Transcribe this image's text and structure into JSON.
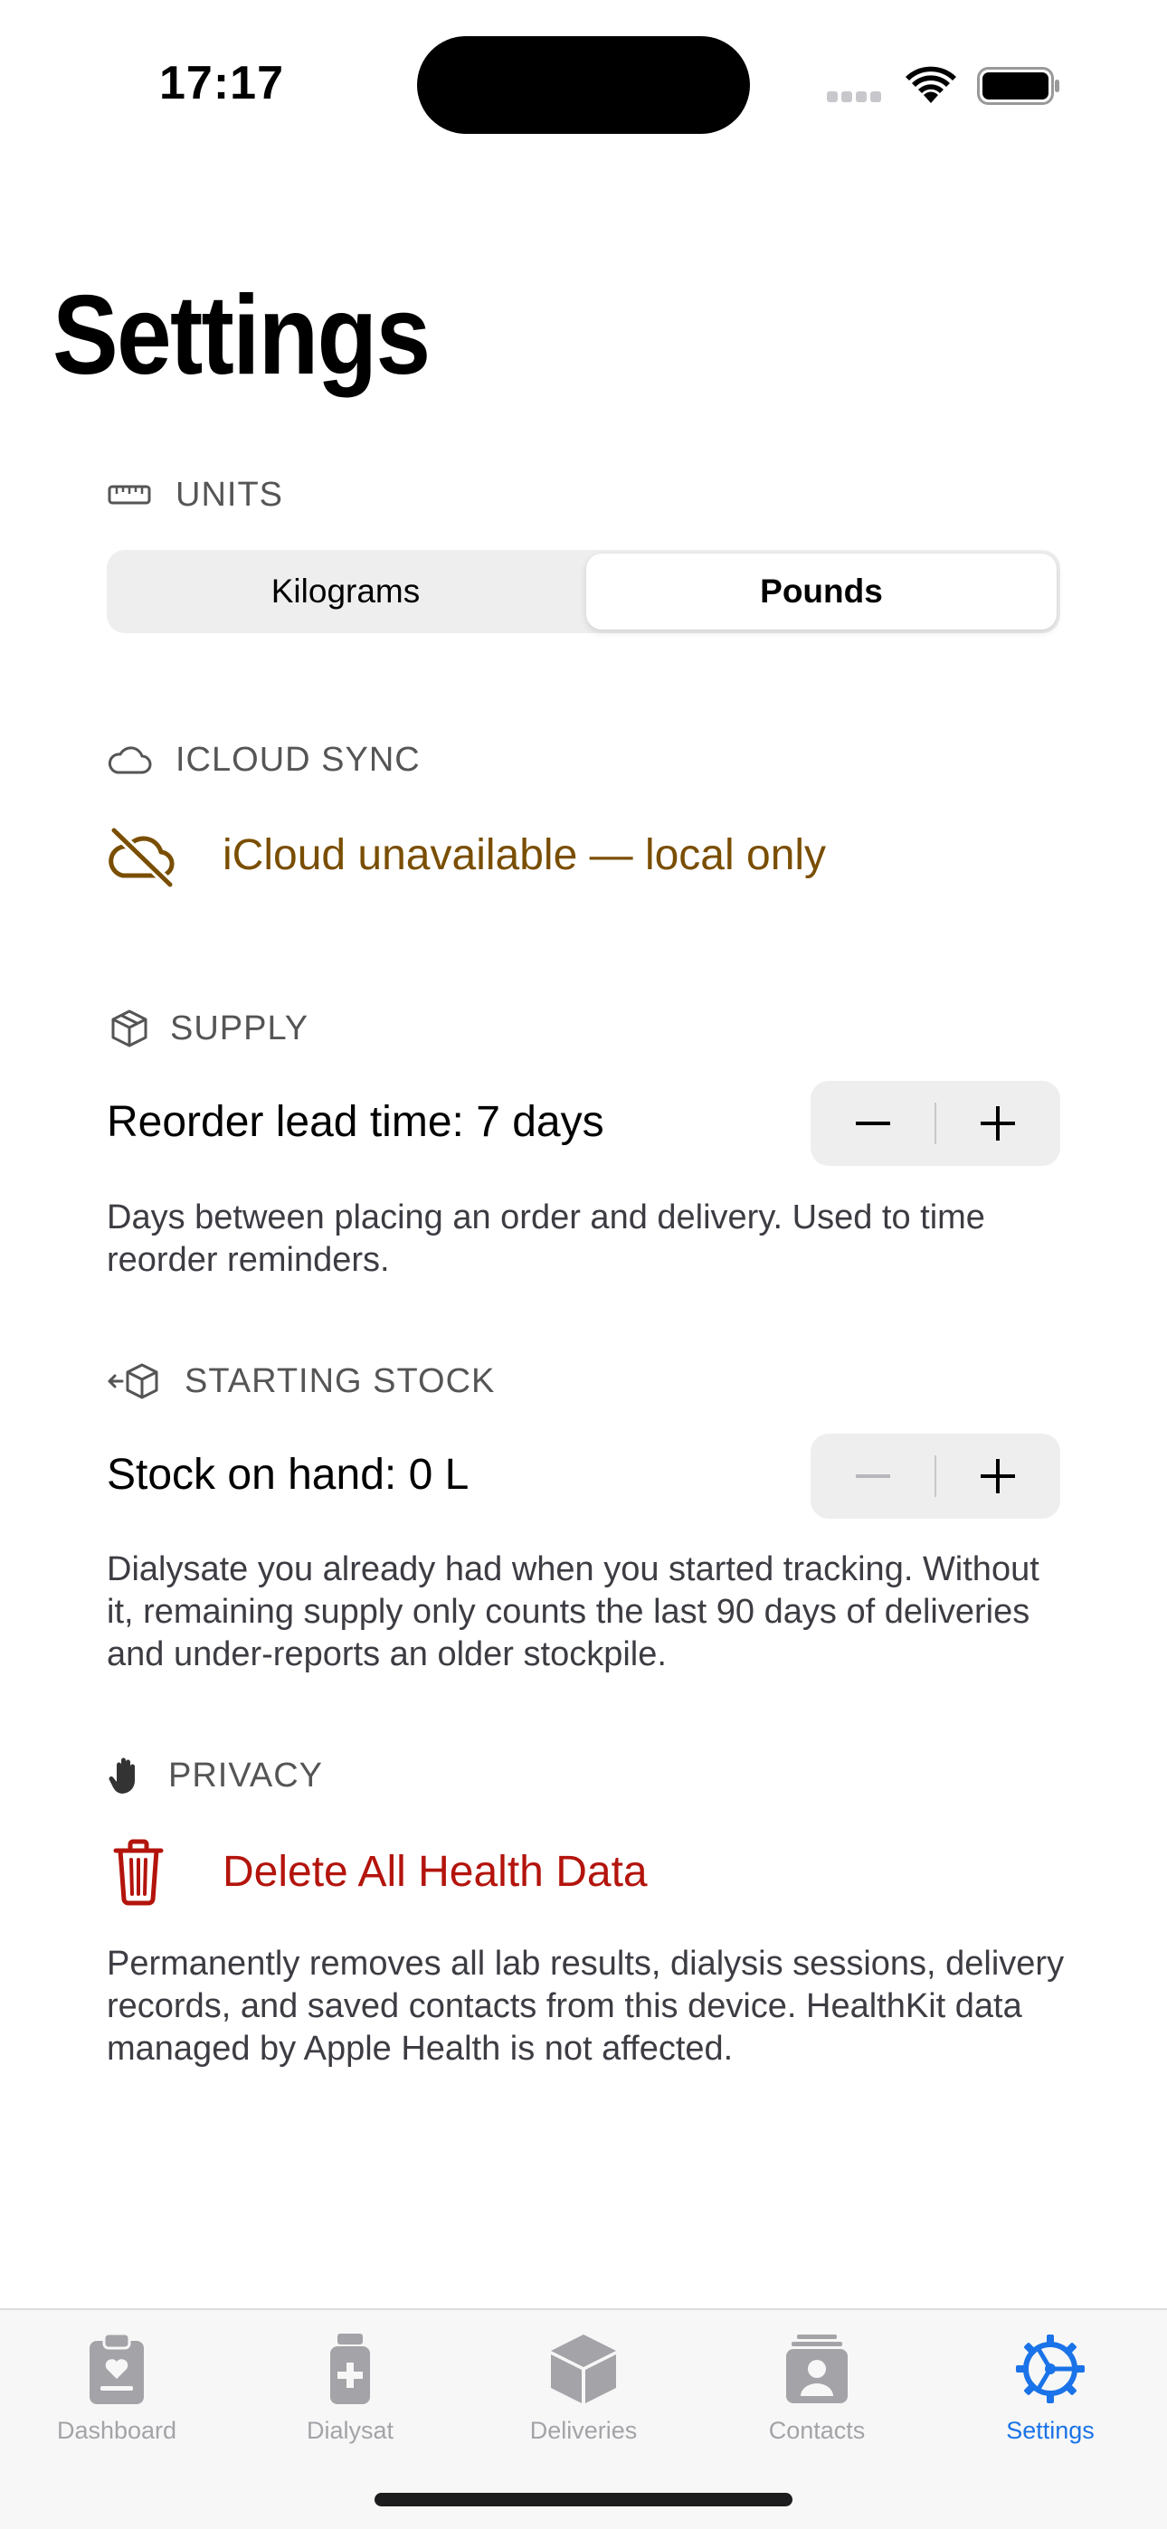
{
  "status_bar": {
    "time": "17:17"
  },
  "page": {
    "title": "Settings"
  },
  "units": {
    "header": "UNITS",
    "header_icon": "ruler-icon",
    "options": [
      "Kilograms",
      "Pounds"
    ],
    "selected": "Pounds"
  },
  "icloud": {
    "header": "ICLOUD SYNC",
    "header_icon": "cloud-icon",
    "status_icon": "cloud-slash-icon",
    "status_text": "iCloud unavailable — local only",
    "status_color": "#7a4e00"
  },
  "supply": {
    "header": "SUPPLY",
    "header_icon": "shipping-box-icon",
    "lead_time_label": "Reorder lead time: 7 days",
    "lead_time_days": 7,
    "footnote": "Days between placing an order and delivery. Used to time reorder reminders."
  },
  "starting_stock": {
    "header": "STARTING STOCK",
    "header_icon": "box-arrow-icon",
    "stock_label": "Stock on hand: 0 L",
    "stock_liters": 0,
    "minus_enabled": false,
    "footnote": "Dialysate you already had when you started tracking. Without it, remaining supply only counts the last 90 days of deliveries and under-reports an older stockpile."
  },
  "privacy": {
    "header": "PRIVACY",
    "header_icon": "hand-raised-icon",
    "delete_icon": "trash-icon",
    "delete_label": "Delete All Health Data",
    "delete_color": "#b3140c",
    "footnote": "Permanently removes all lab results, dialysis sessions, delivery records, and saved contacts from this device. HealthKit data managed by Apple Health is not affected."
  },
  "tab_bar": {
    "tabs": [
      {
        "label": "Dashboard",
        "icon": "clipboard-heart-icon"
      },
      {
        "label": "Dialysat",
        "icon": "medicine-bottle-icon"
      },
      {
        "label": "Deliveries",
        "icon": "shipping-box-icon"
      },
      {
        "label": "Contacts",
        "icon": "contact-cards-icon"
      },
      {
        "label": "Settings",
        "icon": "gear-icon"
      }
    ],
    "active": "Settings",
    "active_color": "#1a73e8",
    "inactive_color": "#a3a3a8"
  }
}
